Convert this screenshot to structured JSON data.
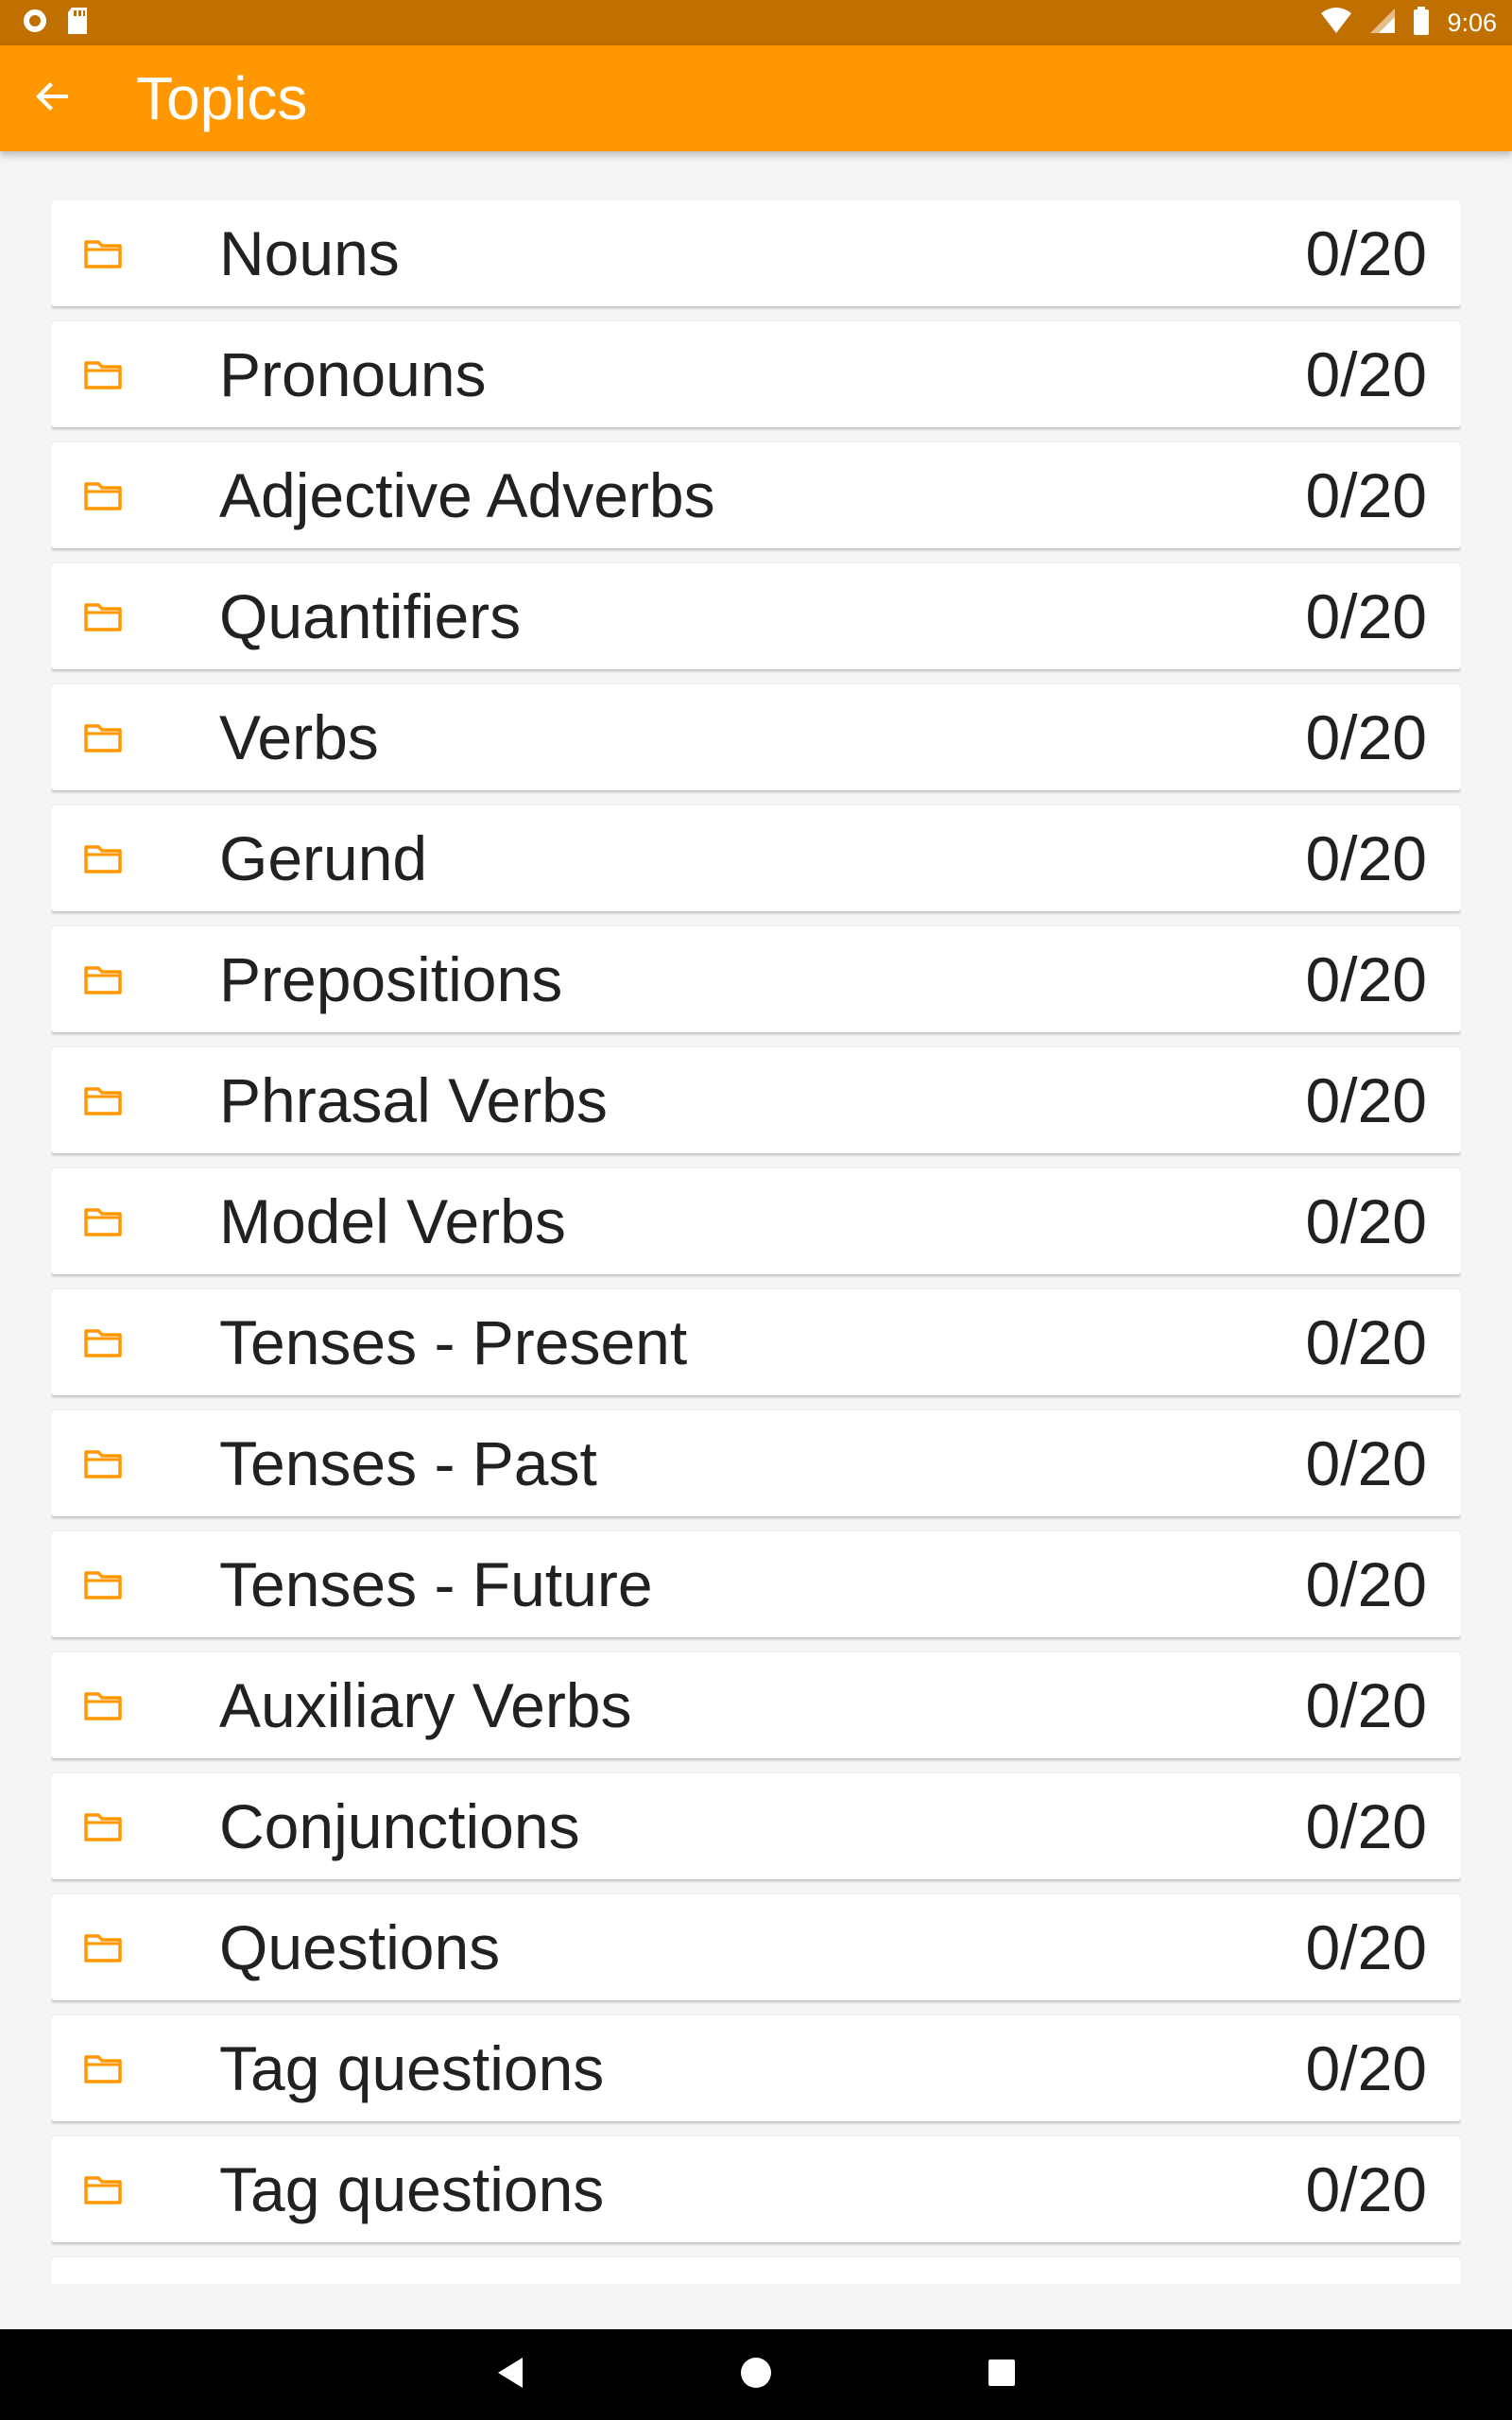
{
  "status_bar": {
    "time": "9:06"
  },
  "app_bar": {
    "title": "Topics",
    "back_icon": "arrow-back-icon"
  },
  "colors": {
    "accent": "#ff9800",
    "status_bar": "#c07000",
    "folder_icon": "#ff9800"
  },
  "topics": [
    {
      "label": "Nouns",
      "count": "0/20"
    },
    {
      "label": "Pronouns",
      "count": "0/20"
    },
    {
      "label": "Adjective Adverbs",
      "count": "0/20"
    },
    {
      "label": "Quantifiers",
      "count": "0/20"
    },
    {
      "label": "Verbs",
      "count": "0/20"
    },
    {
      "label": "Gerund",
      "count": "0/20"
    },
    {
      "label": "Prepositions",
      "count": "0/20"
    },
    {
      "label": "Phrasal Verbs",
      "count": "0/20"
    },
    {
      "label": "Model Verbs",
      "count": "0/20"
    },
    {
      "label": "Tenses - Present",
      "count": "0/20"
    },
    {
      "label": "Tenses - Past",
      "count": "0/20"
    },
    {
      "label": "Tenses - Future",
      "count": "0/20"
    },
    {
      "label": "Auxiliary Verbs",
      "count": "0/20"
    },
    {
      "label": "Conjunctions",
      "count": "0/20"
    },
    {
      "label": "Questions",
      "count": "0/20"
    },
    {
      "label": "Tag questions",
      "count": "0/20"
    },
    {
      "label": "Tag questions",
      "count": "0/20"
    },
    {
      "label": "",
      "count": ""
    }
  ],
  "nav_bar": {
    "back_icon": "nav-back-icon",
    "home_icon": "nav-home-icon",
    "recents_icon": "nav-recents-icon"
  }
}
